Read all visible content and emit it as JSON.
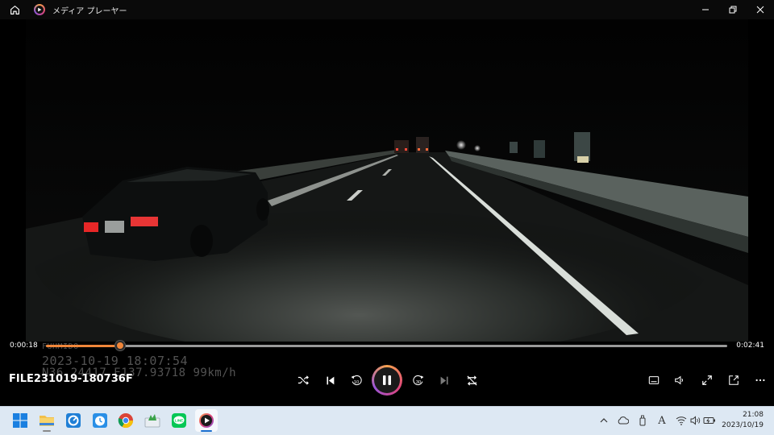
{
  "window": {
    "title": "メディア プレーヤー"
  },
  "video": {
    "overlay_brand": "FUHMIDO",
    "overlay_datetime": "2023-10-19 18:07:54",
    "overlay_gps": "N36.24417 E137.93718 99km/h"
  },
  "player": {
    "current_time": "0:00:18",
    "total_time": "0:02:41",
    "progress_fraction": 0.11,
    "filename": "FILE231019-180736F",
    "skip_back_seconds": "10",
    "skip_forward_seconds": "30",
    "accent_color": "#f0863a"
  },
  "taskbar": {
    "apps": [
      "start",
      "file-explorer",
      "app-blue-1",
      "app-blue-2",
      "chrome",
      "app-green",
      "line",
      "media-player"
    ],
    "active_app": "media-player"
  },
  "tray": {
    "ime": "A",
    "time": "21:08",
    "date": "2023/10/19"
  }
}
